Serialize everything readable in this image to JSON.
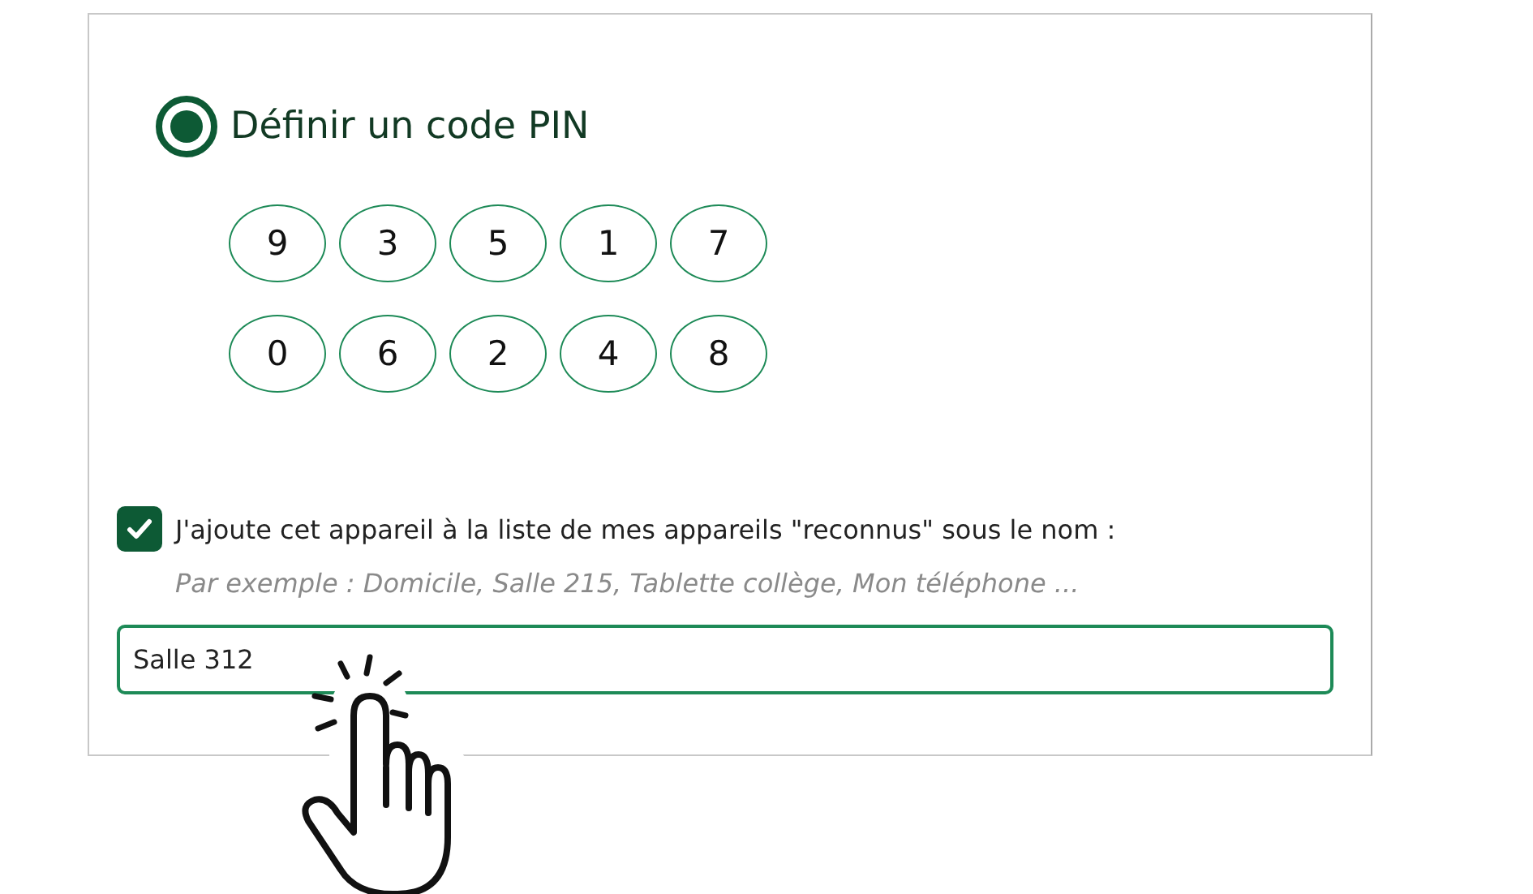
{
  "pin_option": {
    "label": "Définir un code PIN",
    "selected": true
  },
  "pin_keys": [
    [
      "9",
      "3",
      "5",
      "1",
      "7"
    ],
    [
      "0",
      "6",
      "2",
      "4",
      "8"
    ]
  ],
  "device_option": {
    "label": "J'ajoute cet appareil à la liste de mes appareils \"reconnus\" sous le nom :",
    "checked": true,
    "hint": "Par exemple : Domicile, Salle 215, Tablette collège, Mon téléphone ..."
  },
  "name_field": {
    "value": "Salle 312"
  }
}
